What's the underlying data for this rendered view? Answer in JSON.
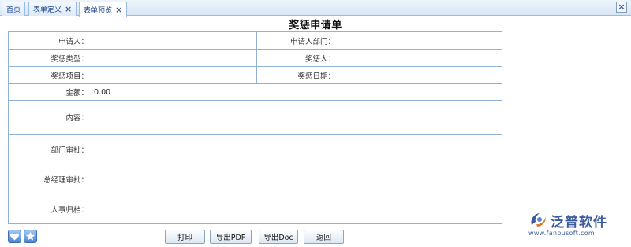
{
  "tabs": [
    {
      "label": "首页",
      "closable": false,
      "active": false
    },
    {
      "label": "表单定义",
      "closable": true,
      "active": false
    },
    {
      "label": "表单预览",
      "closable": true,
      "active": true
    }
  ],
  "close_glyph": "×",
  "form": {
    "title": "奖惩申请单",
    "fields": {
      "applicant": "申请人：",
      "applicant_dept": "申请人部门：",
      "type": "奖惩类型：",
      "target": "奖惩人：",
      "item": "奖惩项目：",
      "date": "奖惩日期：",
      "amount": "金额：",
      "amount_value": "0.00",
      "content": "内容：",
      "dept_approval": "部门审批：",
      "gm_approval": "总经理审批：",
      "hr_archive": "人事归档："
    }
  },
  "buttons": {
    "print": "打印",
    "export_pdf": "导出PDF",
    "export_doc": "导出Doc",
    "back": "返回"
  },
  "logo": {
    "name": "泛普软件",
    "url": "www.fanpusoft.com"
  },
  "icons": [
    "heart-icon",
    "star-icon",
    "close-icon",
    "logo-icon"
  ],
  "colors": {
    "accent": "#99bbe8",
    "border": "#8fb2d6",
    "brand": "#3b5aa0"
  }
}
